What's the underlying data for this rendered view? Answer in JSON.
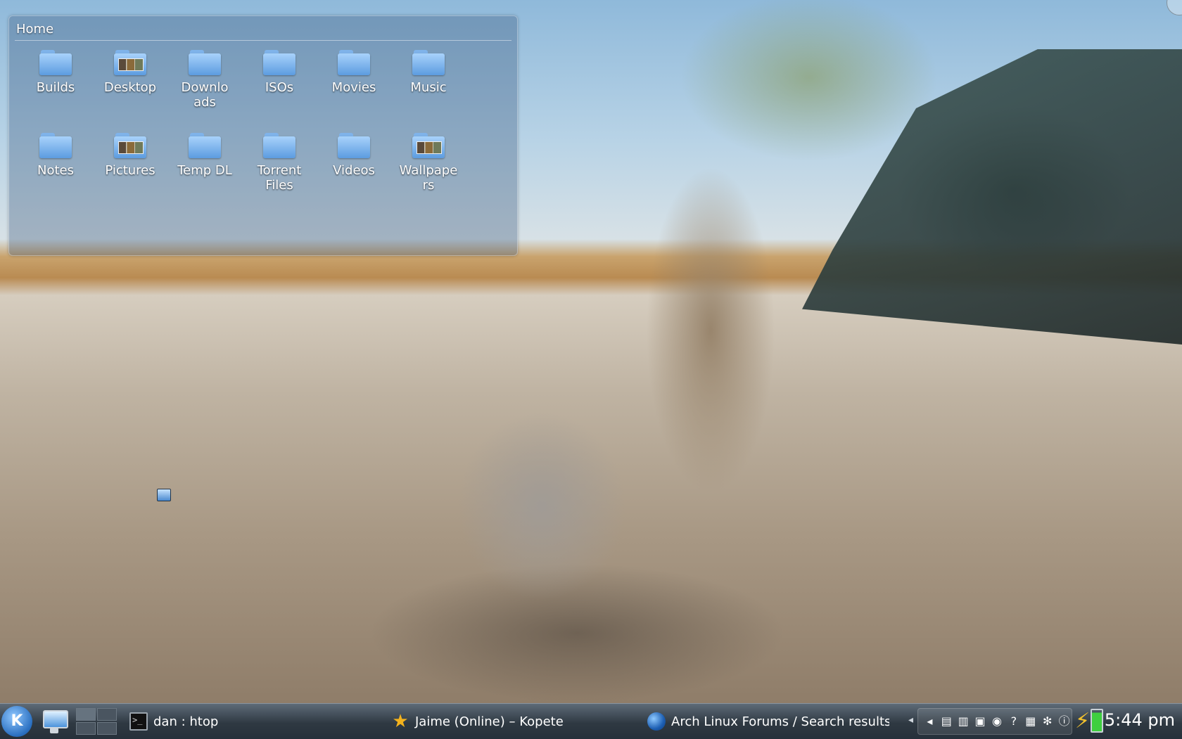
{
  "folder_view": {
    "title": "Home",
    "items": [
      {
        "label": "Builds",
        "icon": "folder-icon"
      },
      {
        "label": "Desktop",
        "icon": "folder-thumbnails-icon"
      },
      {
        "label": "Downloads",
        "icon": "folder-icon"
      },
      {
        "label": "ISOs",
        "icon": "folder-icon"
      },
      {
        "label": "Movies",
        "icon": "folder-icon"
      },
      {
        "label": "Music",
        "icon": "folder-icon"
      },
      {
        "label": "Notes",
        "icon": "folder-icon"
      },
      {
        "label": "Pictures",
        "icon": "folder-thumbnails-icon"
      },
      {
        "label": "Temp DL",
        "icon": "folder-icon"
      },
      {
        "label": "Torrent Files",
        "icon": "folder-icon"
      },
      {
        "label": "Videos",
        "icon": "folder-icon"
      },
      {
        "label": "Wallpapers",
        "icon": "folder-thumbnails-icon"
      }
    ]
  },
  "taskbar": {
    "kmenu_glyph": "K",
    "tasks": [
      {
        "label": "dan : htop",
        "icon": "terminal-icon"
      },
      {
        "label": "Jaime (Online) – Kopete",
        "icon": "kopete-icon"
      },
      {
        "label": "Arch Linux Forums / Search results",
        "icon": "globe-icon"
      }
    ],
    "tray_expand_glyph": "◂",
    "tray_icons": [
      "volume-icon",
      "clipboard-icon",
      "network-icon",
      "display-icon",
      "updates-icon",
      "help-icon",
      "package-icon",
      "settings-icon",
      "info-icon"
    ],
    "clock": "5:44 pm",
    "battery_level": 0.88
  },
  "colors": {
    "taskbar": "#2f3942",
    "folder_blue": "#5c9ce0",
    "battery_green": "#3fcf3f"
  }
}
